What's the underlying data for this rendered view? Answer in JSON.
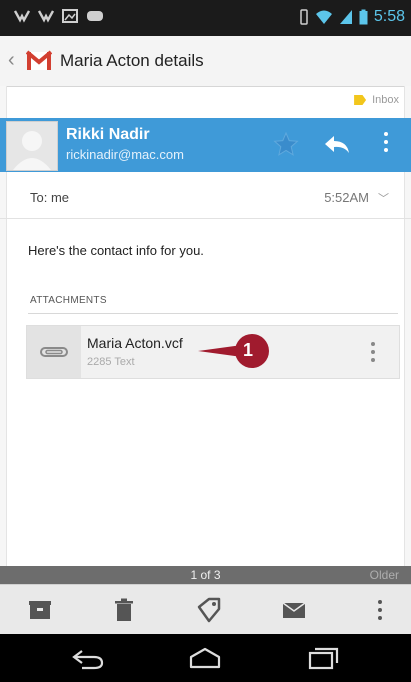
{
  "status_bar": {
    "time": "5:58"
  },
  "action_bar": {
    "title": "Maria Acton details"
  },
  "label": {
    "text": "Inbox",
    "color": "#f2c61c"
  },
  "sender": {
    "name": "Rikki Nadir",
    "email": "rickinadir@mac.com",
    "bar_color": "#3f9ad8"
  },
  "header": {
    "to": "To: me",
    "time": "5:52AM"
  },
  "message": {
    "body": "Here's the contact info for you."
  },
  "attachments": {
    "title": "ATTACHMENTS",
    "items": [
      {
        "name": "Maria Acton.vcf",
        "meta": "2285 Text"
      }
    ]
  },
  "callout": {
    "number": "1",
    "color": "#a01b2e"
  },
  "pager": {
    "position": "1 of 3",
    "older": "Older"
  },
  "toolbar": {
    "actions": [
      "archive-icon",
      "delete-icon",
      "label-icon",
      "mark-unread-icon",
      "overflow-menu-icon"
    ]
  },
  "nav": {
    "buttons": [
      "back-icon",
      "home-icon",
      "recents-icon"
    ]
  }
}
